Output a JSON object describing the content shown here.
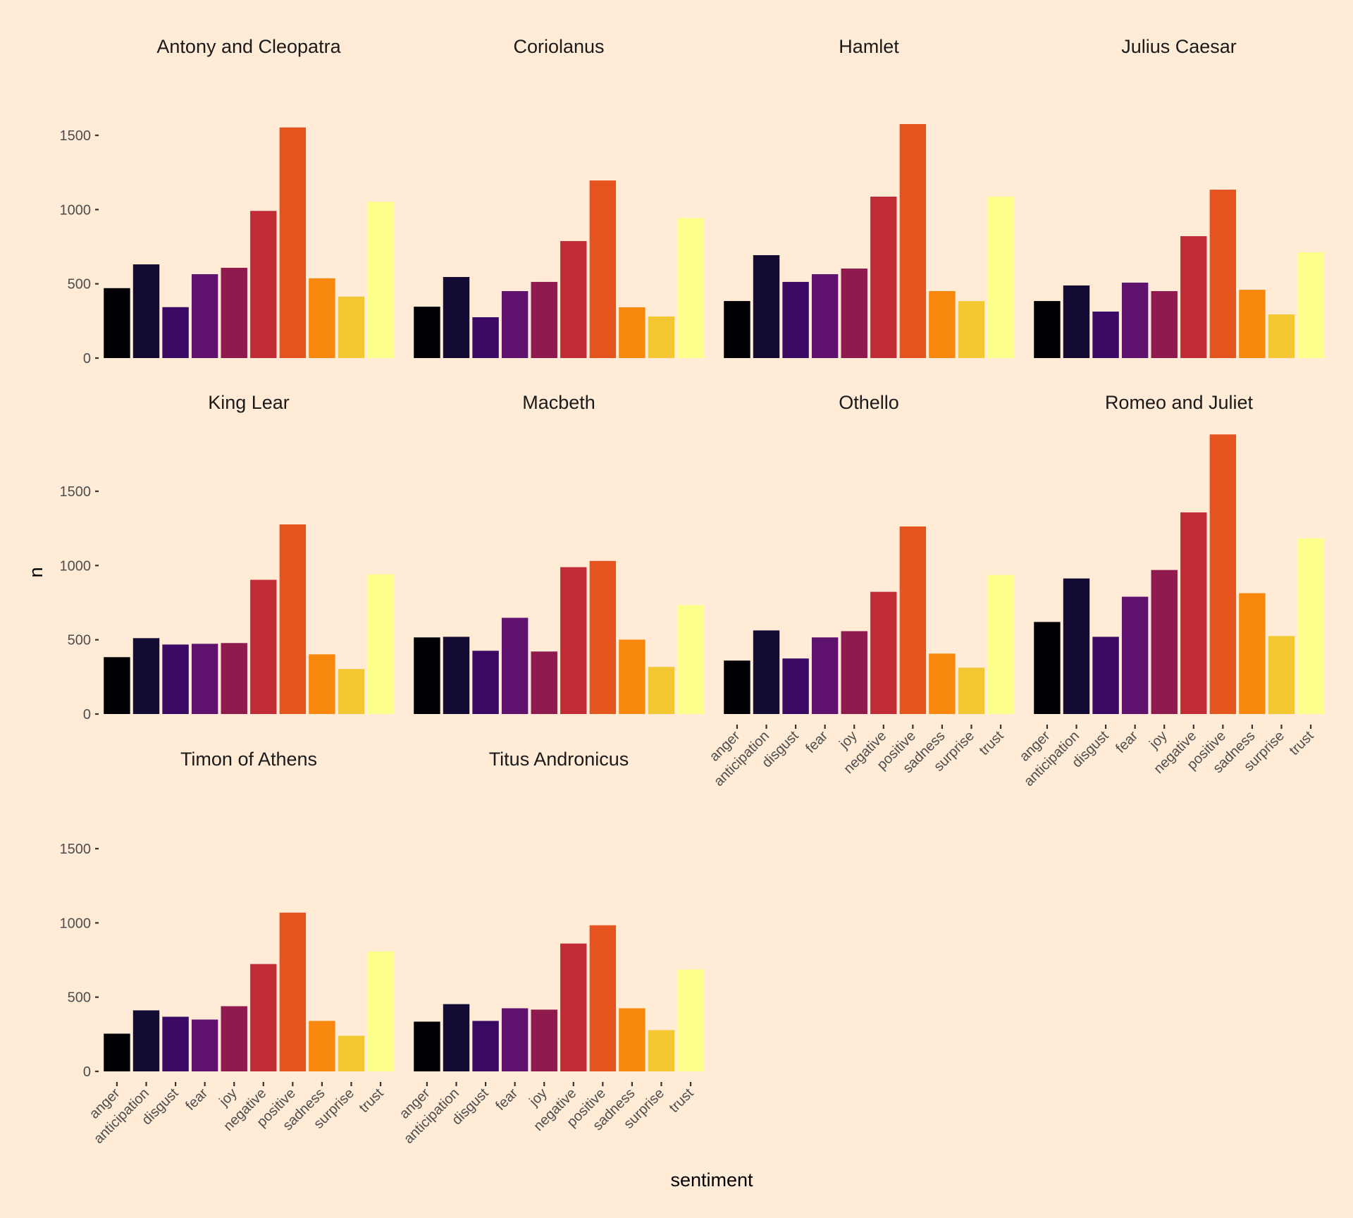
{
  "chart_data": {
    "type": "bar",
    "layout": "facet_wrap",
    "ncol": 4,
    "xlabel": "sentiment",
    "ylabel": "n",
    "ylim": [
      0,
      1950
    ],
    "yticks": [
      0,
      500,
      1000,
      1500
    ],
    "grid": false,
    "legend": "none",
    "categories": [
      "anger",
      "anticipation",
      "disgust",
      "fear",
      "joy",
      "negative",
      "positive",
      "sadness",
      "surprise",
      "trust"
    ],
    "colors": [
      "#000004",
      "#140B34",
      "#390963",
      "#5F136E",
      "#8F1A4D",
      "#C22C36",
      "#E5531E",
      "#F7880D",
      "#F3C731",
      "#FCFF8A"
    ],
    "panels": [
      {
        "title": "Antony and Cleopatra",
        "values": [
          471,
          631,
          343,
          565,
          608,
          991,
          1553,
          537,
          414,
          1052
        ]
      },
      {
        "title": "Coriolanus",
        "values": [
          346,
          546,
          275,
          451,
          513,
          788,
          1196,
          342,
          280,
          943
        ]
      },
      {
        "title": "Hamlet",
        "values": [
          384,
          693,
          513,
          565,
          603,
          1087,
          1576,
          451,
          384,
          1087
        ]
      },
      {
        "title": "Julius Caesar",
        "values": [
          384,
          489,
          313,
          508,
          451,
          821,
          1134,
          460,
          294,
          712
        ]
      },
      {
        "title": "King Lear",
        "values": [
          383,
          511,
          468,
          473,
          478,
          904,
          1277,
          402,
          303,
          941
        ]
      },
      {
        "title": "Macbeth",
        "values": [
          516,
          520,
          426,
          648,
          421,
          989,
          1031,
          501,
          317,
          733
        ]
      },
      {
        "title": "Othello",
        "values": [
          360,
          563,
          374,
          516,
          558,
          823,
          1263,
          407,
          312,
          937
        ]
      },
      {
        "title": "Romeo and Juliet",
        "values": [
          620,
          913,
          520,
          790,
          970,
          1358,
          1883,
          814,
          525,
          1183
        ]
      },
      {
        "title": "Timon of Athens",
        "values": [
          254,
          411,
          368,
          349,
          439,
          723,
          1069,
          340,
          240,
          808
        ]
      },
      {
        "title": "Titus Andronicus",
        "values": [
          335,
          453,
          340,
          425,
          416,
          861,
          984,
          425,
          278,
          686
        ]
      }
    ]
  }
}
